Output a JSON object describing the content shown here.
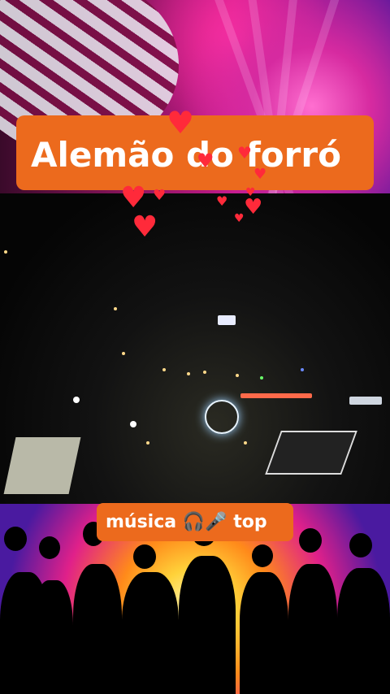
{
  "title": "Alemão do forró",
  "subtitle": "música 🎧🎤 top",
  "colors": {
    "label_background": "#ec6a1d",
    "label_text": "#ffffff",
    "hearts": "#ff2a3a"
  },
  "icons": [
    "heart-icon",
    "headphones-icon",
    "microphone-icon"
  ]
}
